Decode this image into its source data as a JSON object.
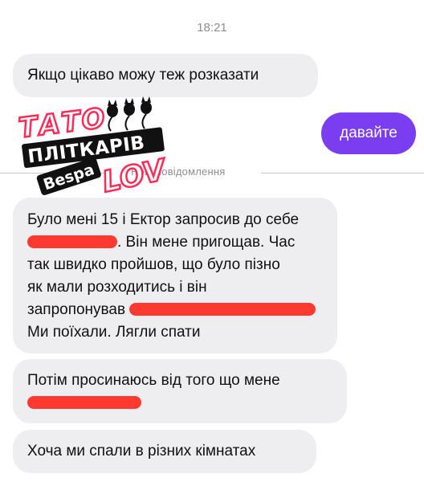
{
  "time": "18:21",
  "messages": {
    "m1": "Якщо цікаво можу теж розказати",
    "outgoing": "давайте",
    "divider": "Нові повідомлення",
    "m2": {
      "line1": "Було мені 15 і Ектор запросив до себе",
      "line2_suffix": ". Він мене пригощав. Час",
      "line3": "так швидко пройшов, що було пізно",
      "line4": "як мали розходитись і він",
      "line5_prefix": "запропонував",
      "line6": "Ми поїхали. Лягли спати"
    },
    "m3": {
      "line1": "Потім просинаюсь від того що мене"
    },
    "m4": "Хоча ми спали в різних кімнатах"
  },
  "logo": {
    "line1": "ТАТО",
    "line2": "ПЛІТКАРІВ",
    "line3": "Bespa",
    "line4": "LOV"
  },
  "colors": {
    "outgoing_bubble": "#7a3df0",
    "incoming_bubble": "#eeeef0",
    "redaction": "#ff2a1f"
  }
}
